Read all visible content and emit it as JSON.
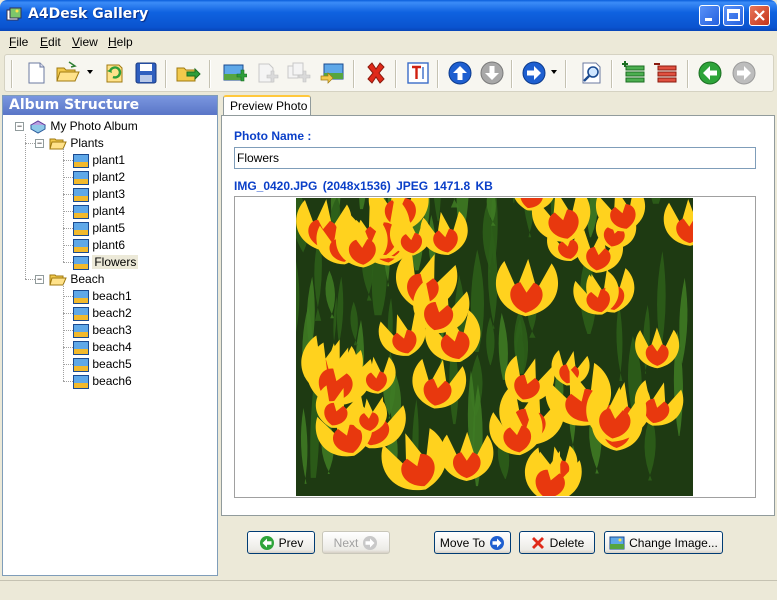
{
  "window": {
    "title": "A4Desk Gallery"
  },
  "menu": [
    {
      "label": "File",
      "key": "F",
      "rest": "ile"
    },
    {
      "label": "Edit",
      "key": "E",
      "rest": "dit"
    },
    {
      "label": "View",
      "key": "V",
      "rest": "iew"
    },
    {
      "label": "Help",
      "key": "H",
      "rest": "elp"
    }
  ],
  "toolbar": {
    "icons": [
      "new-icon",
      "open-icon",
      "reload-icon",
      "save-icon",
      "export-icon",
      "add-photo-icon",
      "add-photo-disabled-icon",
      "add-multiple-disabled-icon",
      "replace-photo-icon",
      "delete-icon",
      "rename-text-icon",
      "move-up-icon",
      "move-down-icon",
      "navigate-icon",
      "preview-icon",
      "expand-icon",
      "collapse-icon",
      "back-icon",
      "forward-icon"
    ]
  },
  "left_pane": {
    "header": "Album Structure",
    "root": "My Photo Album",
    "albums": [
      {
        "name": "Plants",
        "photos": [
          "plant1",
          "plant2",
          "plant3",
          "plant4",
          "plant5",
          "plant6",
          "Flowers"
        ]
      },
      {
        "name": "Beach",
        "photos": [
          "beach1",
          "beach2",
          "beach3",
          "beach4",
          "beach5",
          "beach6"
        ]
      }
    ],
    "selected": "Flowers"
  },
  "preview": {
    "tab_label": "Preview Photo",
    "photo_name_label": "Photo Name :",
    "photo_name_value": "Flowers",
    "file_info": "IMG_0420.JPG  (2048x1536)  JPEG  1471.8 KB"
  },
  "buttons": {
    "prev": "Prev",
    "next": "Next",
    "move_to": "Move To",
    "delete": "Delete",
    "change_image": "Change Image..."
  },
  "colors": {
    "accent_blue": "#0A3FC8",
    "title_blue": "#0A5EDB",
    "close_red": "#C4341A"
  }
}
